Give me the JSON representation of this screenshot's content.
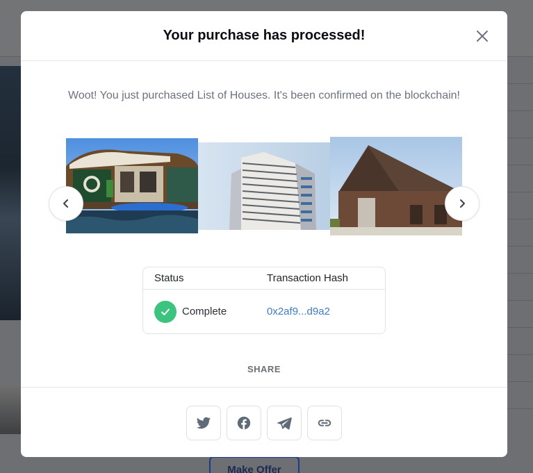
{
  "modal": {
    "title": "Your purchase has processed!",
    "message": "Woot! You just purchased List of Houses. It's been confirmed on the blockchain!"
  },
  "carousel": {
    "images": [
      "houseboat-image",
      "apartment-tower-image",
      "barn-image"
    ]
  },
  "status_table": {
    "headers": {
      "status": "Status",
      "hash": "Transaction Hash"
    },
    "row": {
      "status": "Complete",
      "hash": "0x2af9...d9a2"
    }
  },
  "share": {
    "label": "SHARE",
    "buttons": [
      "twitter-icon",
      "facebook-icon",
      "telegram-icon",
      "link-icon"
    ]
  },
  "background": {
    "offer_button": "Make Offer"
  },
  "colors": {
    "success": "#3ac47d",
    "link": "#3b7bd4",
    "icon": "#5f6b78"
  }
}
